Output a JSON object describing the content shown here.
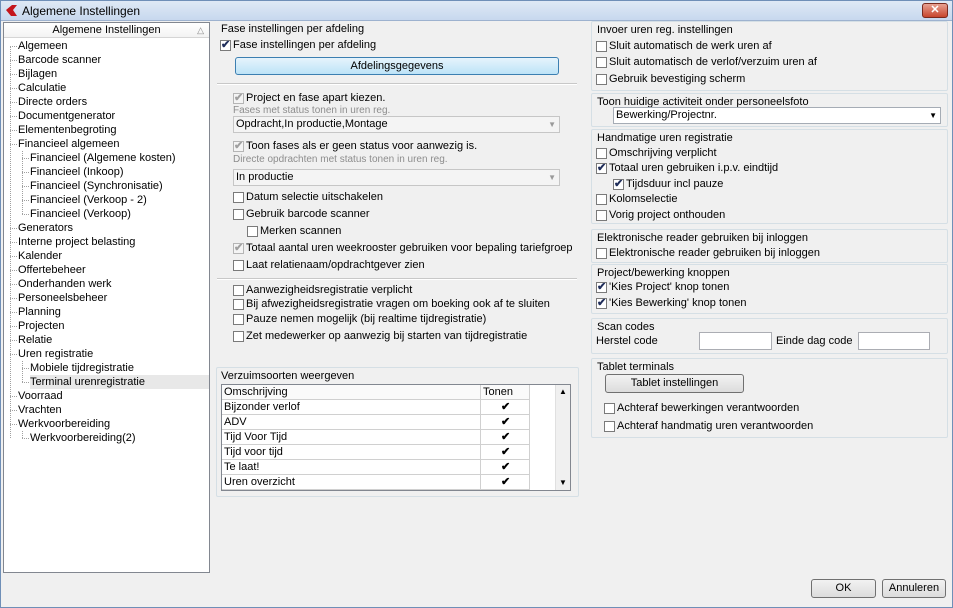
{
  "window": {
    "title": "Algemene Instellingen",
    "close_label": "✕"
  },
  "tree": {
    "header": "Algemene Instellingen",
    "sort_glyph": "△",
    "items": [
      {
        "label": "Algemeen",
        "level": 0
      },
      {
        "label": "Barcode scanner",
        "level": 0
      },
      {
        "label": "Bijlagen",
        "level": 0
      },
      {
        "label": "Calculatie",
        "level": 0
      },
      {
        "label": "Directe orders",
        "level": 0
      },
      {
        "label": "Documentgenerator",
        "level": 0
      },
      {
        "label": "Elementenbegroting",
        "level": 0
      },
      {
        "label": "Financieel algemeen",
        "level": 0
      },
      {
        "label": "Financieel (Algemene kosten)",
        "level": 1
      },
      {
        "label": "Financieel (Inkoop)",
        "level": 1
      },
      {
        "label": "Financieel (Synchronisatie)",
        "level": 1
      },
      {
        "label": "Financieel (Verkoop - 2)",
        "level": 1
      },
      {
        "label": "Financieel (Verkoop)",
        "level": 1
      },
      {
        "label": "Generators",
        "level": 0
      },
      {
        "label": "Interne project belasting",
        "level": 0
      },
      {
        "label": "Kalender",
        "level": 0
      },
      {
        "label": "Offertebeheer",
        "level": 0
      },
      {
        "label": "Onderhanden werk",
        "level": 0
      },
      {
        "label": "Personeelsbeheer",
        "level": 0
      },
      {
        "label": "Planning",
        "level": 0
      },
      {
        "label": "Projecten",
        "level": 0
      },
      {
        "label": "Relatie",
        "level": 0
      },
      {
        "label": "Uren registratie",
        "level": 0
      },
      {
        "label": "Mobiele tijdregistratie",
        "level": 1
      },
      {
        "label": "Terminal urenregistratie",
        "level": 1,
        "selected": true
      },
      {
        "label": "Voorraad",
        "level": 0
      },
      {
        "label": "Vrachten",
        "level": 0
      },
      {
        "label": "Werkvoorbereiding",
        "level": 0
      },
      {
        "label": "Werkvoorbereiding(2)",
        "level": 1
      }
    ]
  },
  "fase": {
    "group_title": "Fase instellingen per afdeling",
    "enable_label": "Fase instellingen per afdeling",
    "button_label": "Afdelingsgegevens",
    "project_fase_label": "Project en fase apart kiezen.",
    "status_hint": "Fases met status tonen in uren reg.",
    "status_combo": "Opdracht,In productie,Montage",
    "toon_fases_label": "Toon fases als er geen status voor aanwezig is.",
    "direct_hint": "Directe opdrachten met status tonen in uren reg.",
    "direct_combo": "In productie",
    "datum_label": "Datum selectie uitschakelen",
    "barcode_label": "Gebruik barcode scanner",
    "merken_label": "Merken scannen",
    "totaal_label": "Totaal aantal uren weekrooster gebruiken voor bepaling tariefgroep",
    "relatie_label": "Laat relatienaam/opdrachtgever zien",
    "aanwezig_label": "Aanwezigheidsregistratie verplicht",
    "afwezig_label": "Bij afwezigheidsregistratie vragen om boeking ook af te sluiten",
    "pauze_label": "Pauze nemen mogelijk (bij realtime tijdregistratie)",
    "zet_label": "Zet medewerker op aanwezig bij starten van tijdregistratie"
  },
  "verzuim": {
    "group_title": "Verzuimsoorten weergeven",
    "col_omschrijving": "Omschrijving",
    "col_tonen": "Tonen",
    "rows": [
      {
        "label": "Bijzonder verlof",
        "tonen": "✔"
      },
      {
        "label": "ADV",
        "tonen": "✔"
      },
      {
        "label": "Tijd Voor Tijd",
        "tonen": "✔"
      },
      {
        "label": "Tijd voor tijd",
        "tonen": "✔"
      },
      {
        "label": "Te laat!",
        "tonen": "✔"
      },
      {
        "label": "Uren overzicht",
        "tonen": "✔"
      }
    ],
    "scroll_up": "▲",
    "scroll_down": "▼"
  },
  "invoer": {
    "group_title": "Invoer uren reg. instellingen",
    "sluit_werk_label": "Sluit automatisch de werk uren af",
    "sluit_verlof_label": "Sluit automatisch de verlof/verzuim uren af",
    "bevestiging_label": "Gebruik bevestiging scherm"
  },
  "activiteit": {
    "group_title": "Toon huidige activiteit onder personeelsfoto",
    "combo_value": "Bewerking/Projectnr."
  },
  "handmatig": {
    "group_title": "Handmatige uren registratie",
    "omschrijving_label": "Omschrijving verplicht",
    "totaal_label": "Totaal uren gebruiken i.p.v. eindtijd",
    "tijdsduur_label": "Tijdsduur incl pauze",
    "kolom_label": "Kolomselectie",
    "vorig_label": "Vorig project onthouden"
  },
  "reader": {
    "group_title": "Elektronische reader gebruiken bij inloggen",
    "label": "Elektronische reader gebruiken bij inloggen"
  },
  "knoppen": {
    "group_title": "Project/bewerking knoppen",
    "project_label": "'Kies Project' knop tonen",
    "bewerking_label": "'Kies Bewerking' knop tonen"
  },
  "scan": {
    "group_title": "Scan codes",
    "herstel_label": "Herstel code",
    "einde_label": "Einde dag code",
    "herstel_value": "",
    "einde_value": ""
  },
  "tablet": {
    "group_title": "Tablet terminals",
    "button_label": "Tablet instellingen",
    "bewerkingen_label": "Achteraf bewerkingen verantwoorden",
    "handmatig_label": "Achteraf handmatig uren verantwoorden"
  },
  "footer": {
    "ok_label": "OK",
    "cancel_label": "Annuleren"
  },
  "check_glyph": "✔"
}
